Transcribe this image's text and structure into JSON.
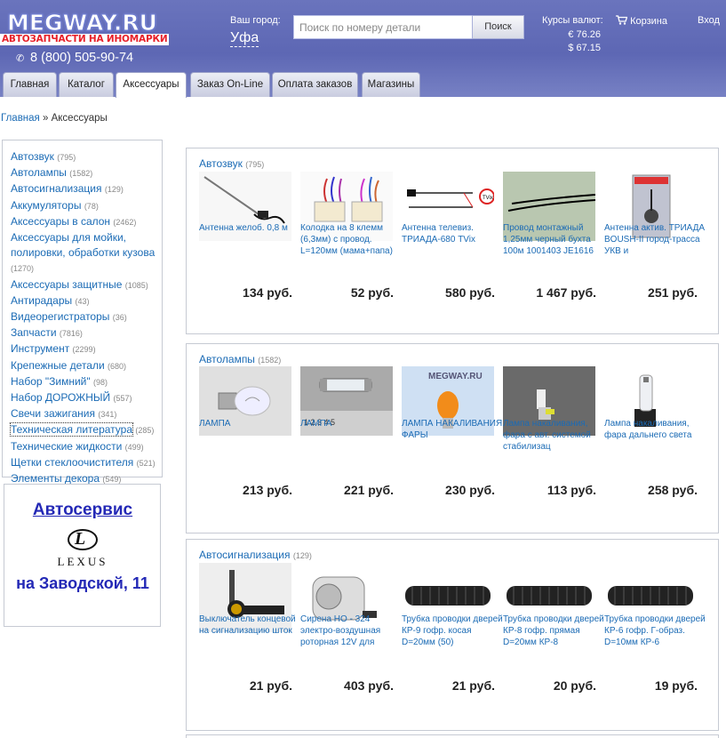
{
  "header": {
    "logo_top": "MEGWAY.RU",
    "logo_bottom": "АВТОЗАПЧАСТИ НА ИНОМАРКИ",
    "phone": "8 (800) 505-90-74",
    "city_label": "Ваш город:",
    "city_value": "Уфа",
    "search_placeholder": "Поиск по номеру детали",
    "search_button": "Поиск",
    "rates_label": "Курсы валют:",
    "rate_eur": "€ 76.26",
    "rate_usd": "$ 67.15",
    "cart": "Корзина",
    "login": "Вход"
  },
  "tabs": [
    {
      "label": "Главная",
      "active": false
    },
    {
      "label": "Каталог",
      "active": false
    },
    {
      "label": "Аксессуары",
      "active": true
    },
    {
      "label": "Заказ On-Line",
      "active": false
    },
    {
      "label": "Оплата заказов",
      "active": false
    },
    {
      "label": "Магазины",
      "active": false
    }
  ],
  "breadcrumb": {
    "home": "Главная",
    "separator": "»",
    "current": "Аксессуары"
  },
  "sidebar": {
    "categories": [
      {
        "label": "Автозвук",
        "count": "(795)"
      },
      {
        "label": "Автолампы",
        "count": "(1582)"
      },
      {
        "label": "Автосигнализация",
        "count": "(129)"
      },
      {
        "label": "Аккумуляторы",
        "count": "(78)"
      },
      {
        "label": "Аксессуары в салон",
        "count": "(2462)"
      },
      {
        "label": "Аксессуары для мойки, полировки, обработки кузова",
        "count": "(1270)"
      },
      {
        "label": "Аксессуары защитные",
        "count": "(1085)"
      },
      {
        "label": "Антирадары",
        "count": "(43)"
      },
      {
        "label": "Видеорегистраторы",
        "count": "(36)"
      },
      {
        "label": "Запчасти",
        "count": "(7816)"
      },
      {
        "label": "Инструмент",
        "count": "(2299)"
      },
      {
        "label": "Крепежные детали",
        "count": "(680)"
      },
      {
        "label": "Набор \"Зимний\"",
        "count": "(98)"
      },
      {
        "label": "Набор ДОРОЖНЫЙ",
        "count": "(557)"
      },
      {
        "label": "Свечи зажигания",
        "count": "(341)"
      },
      {
        "label": "Техническая литература",
        "count": "(285)"
      },
      {
        "label": "Технические жидкости",
        "count": "(499)"
      },
      {
        "label": "Щетки стеклоочистителя",
        "count": "(521)"
      },
      {
        "label": "Элементы декора",
        "count": "(549)"
      }
    ],
    "banner": {
      "title": "Автосервис",
      "brand": "LEXUS",
      "address": "на Заводской, 11"
    }
  },
  "blocks": [
    {
      "title": "Автозвук",
      "count": "(795)",
      "products": [
        {
          "name": "Антенна желоб. 0,8 м",
          "price": "134 руб.",
          "icon": "antenna-image"
        },
        {
          "name": "Колодка на 8 клемм (6,3мм) с провод. L=120мм (мама+папа)",
          "price": "52 руб.",
          "icon": "connector-image"
        },
        {
          "name": "Антенна телевиз. ТРИАДА-680 TVix",
          "price": "580 руб.",
          "icon": "tv-antenna-image"
        },
        {
          "name": "Провод монтажный 1,25мм черный бухта 100м 1001403 JE1616",
          "price": "1 467 руб.",
          "icon": "wire-image"
        },
        {
          "name": "Антенна актив. ТРИАДА BOUSH-II город-трасса УКВ и",
          "price": "251 руб.",
          "icon": "antenna-box-image"
        }
      ]
    },
    {
      "title": "Автолампы",
      "count": "(1582)",
      "products": [
        {
          "name": "ЛАМПА",
          "price": "213 руб.",
          "icon": "bulb-image"
        },
        {
          "name": "ЛАМПА",
          "price": "221 руб.",
          "icon": "fuse-bulb-image"
        },
        {
          "name": "ЛАМПА НАКАЛИВАНИЯ ФАРЫ",
          "price": "230 руб.",
          "icon": "orange-bulb-image"
        },
        {
          "name": "Лампа накаливания, фара с авт. системой стабилизац",
          "price": "113 руб.",
          "icon": "xenon-bulb-image"
        },
        {
          "name": "Лампа накаливания, фара дальнего света",
          "price": "258 руб.",
          "icon": "headlight-bulb-image"
        }
      ]
    },
    {
      "title": "Автосигнализация",
      "count": "(129)",
      "products": [
        {
          "name": "Выключатель концевой на сигнализацию шток",
          "price": "21 руб.",
          "icon": "switch-image"
        },
        {
          "name": "Сирена НО - 324 электро-воздушная роторная 12V для",
          "price": "403 руб.",
          "icon": "siren-image"
        },
        {
          "name": "Трубка проводки дверей КР-9 гофр. косая D=20мм (50)",
          "price": "21 руб.",
          "icon": "tube-image"
        },
        {
          "name": "Трубка проводки дверей КР-8 гофр. прямая D=20мм КР-8",
          "price": "20 руб.",
          "icon": "tube-image"
        },
        {
          "name": "Трубка проводки дверей КР-6 гофр. Г-образ. D=10мм КР-6",
          "price": "19 руб.",
          "icon": "tube-image"
        }
      ]
    }
  ]
}
